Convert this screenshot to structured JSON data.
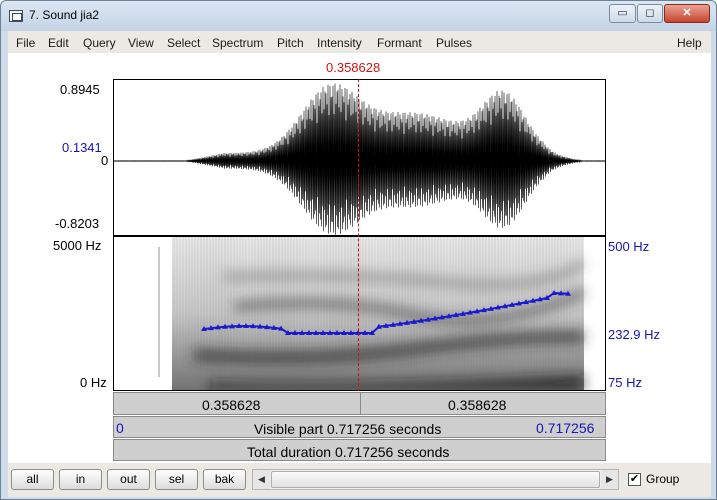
{
  "window": {
    "title": "7. Sound jia2",
    "min_glyph": "▭",
    "max_glyph": "◻",
    "close_glyph": "✕"
  },
  "menu": [
    "File",
    "Edit",
    "Query",
    "View",
    "Select",
    "Spectrum",
    "Pitch",
    "Intensity",
    "Formant",
    "Pulses",
    "Help"
  ],
  "cursor": {
    "time_label": "0.358628"
  },
  "waveform": {
    "max_label": "0.8945",
    "mid_label": "0.1341",
    "zero_label": "0",
    "min_label": "-0.8203"
  },
  "spectrogram": {
    "top_label": "5000 Hz",
    "bottom_label": "0 Hz"
  },
  "pitch": {
    "top_label": "500 Hz",
    "mid_label": "232.9 Hz",
    "bottom_label": "75 Hz",
    "color": "#1a1ad0"
  },
  "bars": {
    "left_time": "0.358628",
    "right_time": "0.358628",
    "visible_start": "0",
    "visible_part": "Visible part 0.717256 seconds",
    "visible_end": "0.717256",
    "total_duration": "Total duration 0.717256 seconds"
  },
  "toolbar": {
    "buttons": [
      "all",
      "in",
      "out",
      "sel",
      "bak"
    ],
    "group_label": "Group",
    "group_checked": "✔",
    "scroll_left": "◀",
    "scroll_right": "▶"
  }
}
